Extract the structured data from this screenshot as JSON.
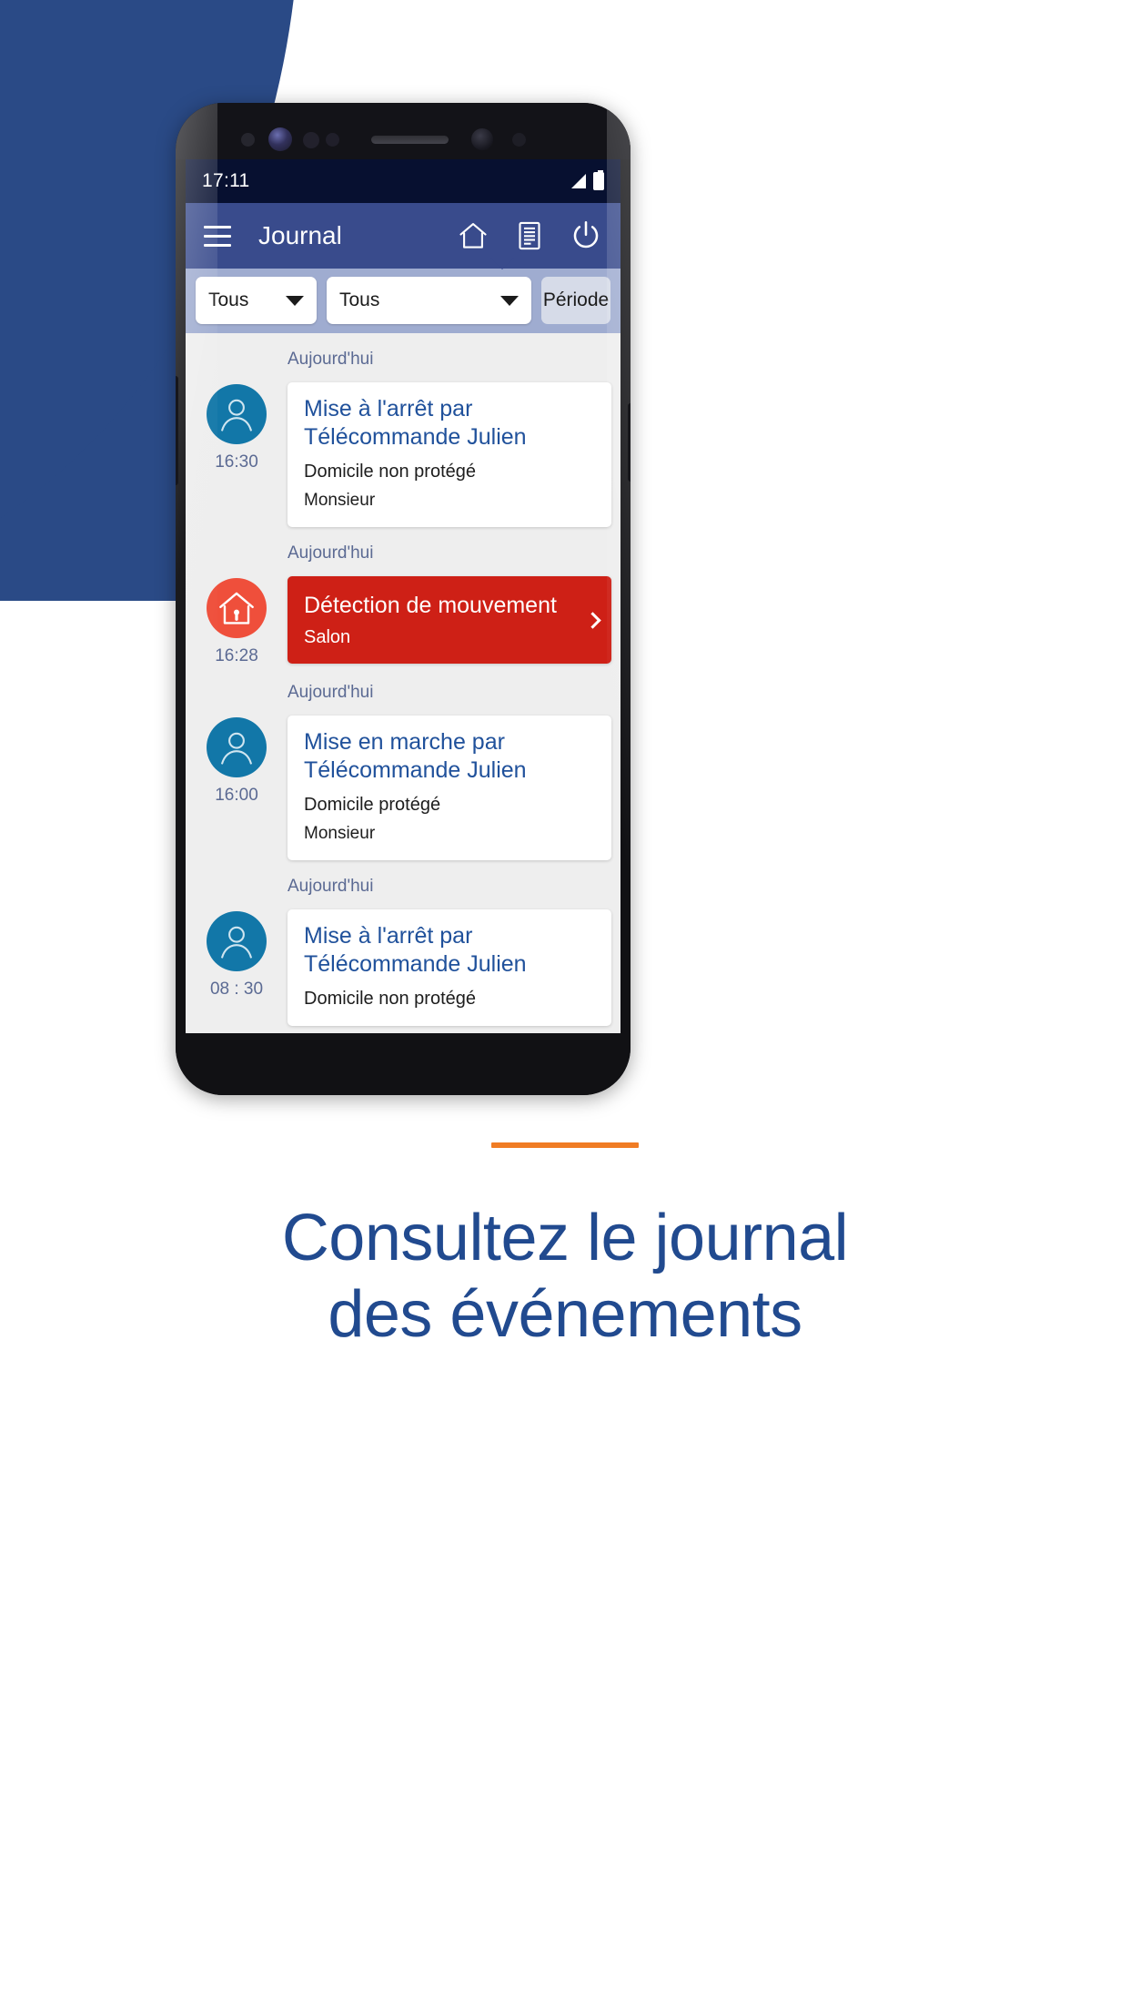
{
  "background": {
    "accent_blue": "#2a4a86",
    "page_bg": "#ffffff"
  },
  "phone": {
    "status_bar": {
      "time": "17:11",
      "signal_icon": "signal-bars-icon",
      "battery_icon": "battery-full-icon",
      "bg_color": "#071030"
    },
    "app_bar": {
      "menu_icon": "hamburger-menu-icon",
      "title": "Journal",
      "bg_color": "#394b8c",
      "actions": [
        {
          "icon": "home-outline-icon",
          "name": "home-button"
        },
        {
          "icon": "journal-list-icon",
          "name": "journal-button"
        },
        {
          "icon": "power-icon",
          "name": "power-button"
        }
      ]
    },
    "filter_bar": {
      "bg_color": "#9facd0",
      "filters": [
        {
          "name": "type-filter",
          "value": "Tous",
          "caret": "chevron-down-icon"
        },
        {
          "name": "device-filter",
          "value": "Tous",
          "caret": "chevron-down-icon"
        }
      ],
      "period_button": "Période"
    },
    "feed": {
      "bg_color": "#eeeeee",
      "entries": [
        {
          "day": "Aujourd'hui",
          "time": "16:30",
          "avatar": "user-avatar-icon",
          "avatar_color": "#1277a8",
          "kind": "info",
          "title": "Mise à l'arrêt par Télécommande Julien",
          "subtitle": "Domicile non protégé",
          "detail": "Monsieur"
        },
        {
          "day": "Aujourd'hui",
          "time": "16:28",
          "avatar": "house-alarm-icon",
          "avatar_color": "#ef4f3b",
          "kind": "alert",
          "title": "Détection de mouvement",
          "subtitle": "Salon",
          "detail": "",
          "chevron": "chevron-right-icon",
          "card_color": "#ce2016"
        },
        {
          "day": "Aujourd'hui",
          "time": "16:00",
          "avatar": "user-avatar-icon",
          "avatar_color": "#1277a8",
          "kind": "info",
          "title": "Mise en marche par Télécommande Julien",
          "subtitle": "Domicile protégé",
          "detail": "Monsieur"
        },
        {
          "day": "Aujourd'hui",
          "time": "08 : 30",
          "avatar": "user-avatar-icon",
          "avatar_color": "#1277a8",
          "kind": "info",
          "title": "Mise à l'arrêt par Télécommande Julien",
          "subtitle": "Domicile non protégé",
          "detail": ""
        }
      ]
    }
  },
  "caption": {
    "rule_color": "#f07c24",
    "line1": "Consultez le journal",
    "line2": "des événements",
    "text_color": "#214a8f"
  }
}
